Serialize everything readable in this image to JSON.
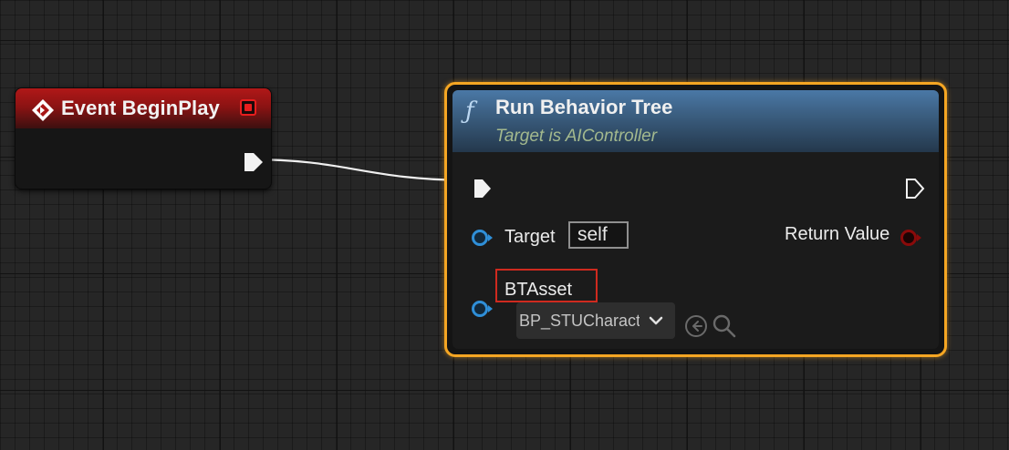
{
  "event_node": {
    "title": "Event BeginPlay"
  },
  "function_node": {
    "title": "Run Behavior Tree",
    "subtitle": "Target is AIController",
    "target_label": "Target",
    "target_value": "self",
    "return_label": "Return Value",
    "btasset_label": "BTAsset",
    "btasset_value": "BP_STUCharacter"
  },
  "colors": {
    "accent_selected": "#f5a623",
    "event_header": "#b01818",
    "function_header": "#4a78a6",
    "object_pin": "#2f8fd8",
    "return_pin": "#8a0a0a",
    "highlight": "#cf2a1f"
  },
  "icons": {
    "event": "event-diamond-icon",
    "function": "function-icon",
    "exec_pin": "exec-pin-icon",
    "object_pin": "object-pin-icon",
    "delegate": "delegate-pin-icon",
    "dropdown": "chevron-down-icon",
    "browse": "browse-arrow-icon",
    "find": "search-icon"
  }
}
